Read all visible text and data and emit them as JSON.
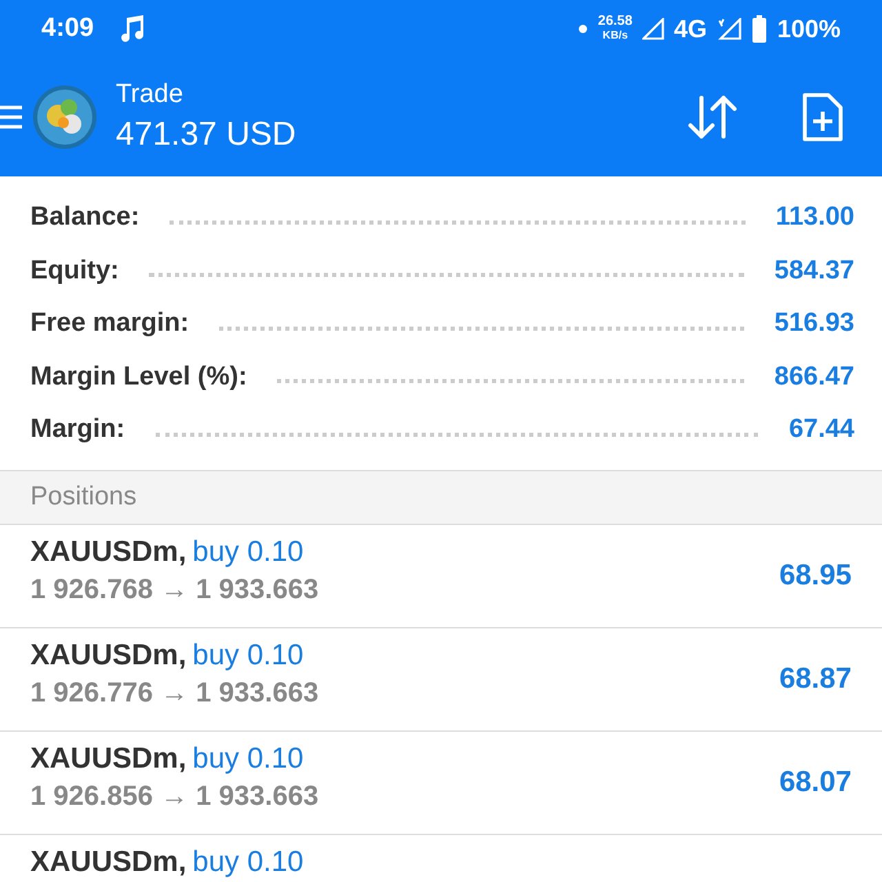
{
  "status_bar": {
    "time": "4:09",
    "net_speed": "26.58",
    "net_unit": "KB/s",
    "network": "4G",
    "battery": "100%"
  },
  "header": {
    "title": "Trade",
    "balance": "471.37 USD"
  },
  "summary": [
    {
      "label": "Balance:",
      "value": "113.00"
    },
    {
      "label": "Equity:",
      "value": "584.37"
    },
    {
      "label": "Free margin:",
      "value": "516.93"
    },
    {
      "label": "Margin Level (%):",
      "value": "866.47"
    },
    {
      "label": "Margin:",
      "value": "67.44"
    }
  ],
  "positions": {
    "title": "Positions",
    "rows": [
      {
        "symbol": "XAUUSDm,",
        "order": "buy 0.10",
        "prices": "1 926.768 → 1 933.663",
        "profit": "68.95"
      },
      {
        "symbol": "XAUUSDm,",
        "order": "buy 0.10",
        "prices": "1 926.776 → 1 933.663",
        "profit": "68.87"
      },
      {
        "symbol": "XAUUSDm,",
        "order": "buy 0.10",
        "prices": "1 926.856 → 1 933.663",
        "profit": "68.07"
      },
      {
        "symbol": "XAUUSDm,",
        "order": "buy 0.10"
      }
    ]
  }
}
